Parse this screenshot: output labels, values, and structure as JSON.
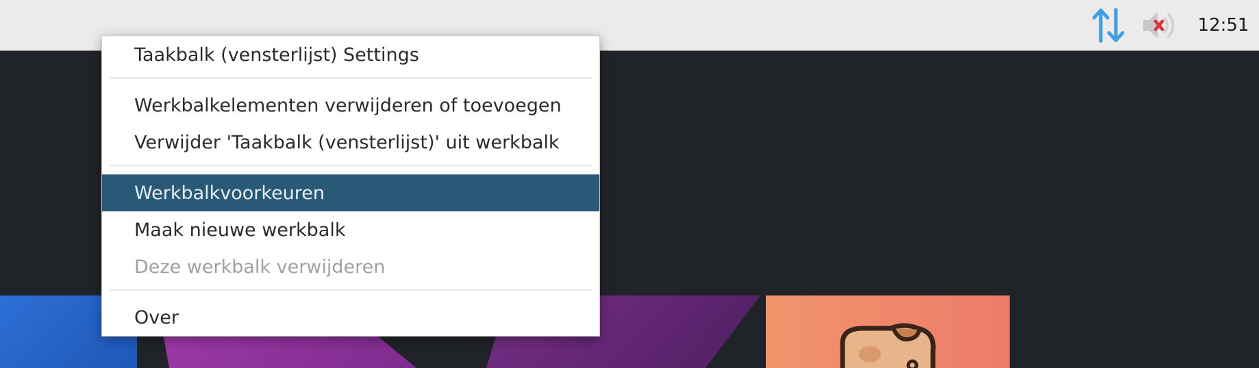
{
  "panel": {
    "clock": "12:51",
    "network_icon": "network-transfer-arrows-icon",
    "volume_icon": "volume-muted-icon",
    "accent_color": "#3d9ee8",
    "muted_x_color": "#e0303a"
  },
  "context_menu": {
    "items": [
      {
        "label": "Taakbalk (vensterlijst) Settings",
        "state": "normal"
      },
      {
        "label": "Werkbalkelementen verwijderen of toevoegen",
        "state": "normal"
      },
      {
        "label": "Verwijder 'Taakbalk (vensterlijst)' uit werkbalk",
        "state": "normal"
      },
      {
        "label": "Werkbalkvoorkeuren",
        "state": "highlighted"
      },
      {
        "label": "Maak nieuwe werkbalk",
        "state": "normal"
      },
      {
        "label": "Deze werkbalk verwijderen",
        "state": "disabled"
      },
      {
        "label": "Over",
        "state": "normal"
      }
    ],
    "highlight_color": "#285a78"
  }
}
